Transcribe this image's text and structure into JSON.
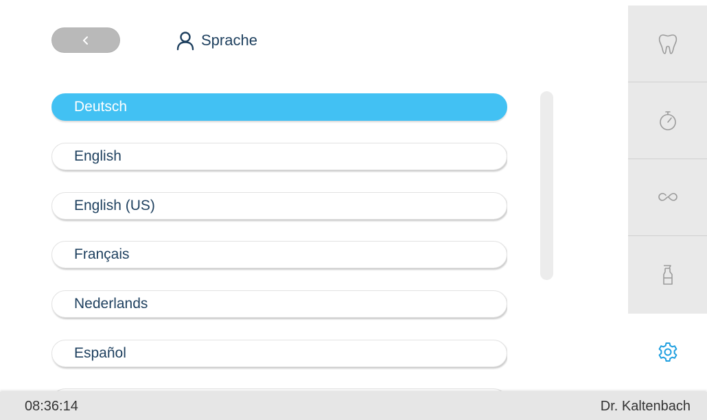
{
  "header": {
    "title": "Sprache",
    "back_icon": "chevron-left-icon",
    "title_icon": "user-icon"
  },
  "languages": [
    {
      "label": "Deutsch",
      "selected": true
    },
    {
      "label": "English",
      "selected": false
    },
    {
      "label": "English (US)",
      "selected": false
    },
    {
      "label": "Français",
      "selected": false
    },
    {
      "label": "Nederlands",
      "selected": false
    },
    {
      "label": "Español",
      "selected": false
    },
    {
      "label": "",
      "selected": false
    }
  ],
  "sidebar": {
    "tabs": [
      {
        "icon": "tooth-icon"
      },
      {
        "icon": "stopwatch-icon"
      },
      {
        "icon": "infinity-icon"
      },
      {
        "icon": "spray-bottle-icon"
      }
    ],
    "settings_icon": "gear-icon"
  },
  "status_bar": {
    "time": "08:36:14",
    "user": "Dr. Kaltenbach"
  },
  "colors": {
    "accent": "#42c1f3",
    "text": "#1d3f5e",
    "sidebar_bg": "#e9e9e9",
    "status_bg": "#e6e6e6"
  }
}
